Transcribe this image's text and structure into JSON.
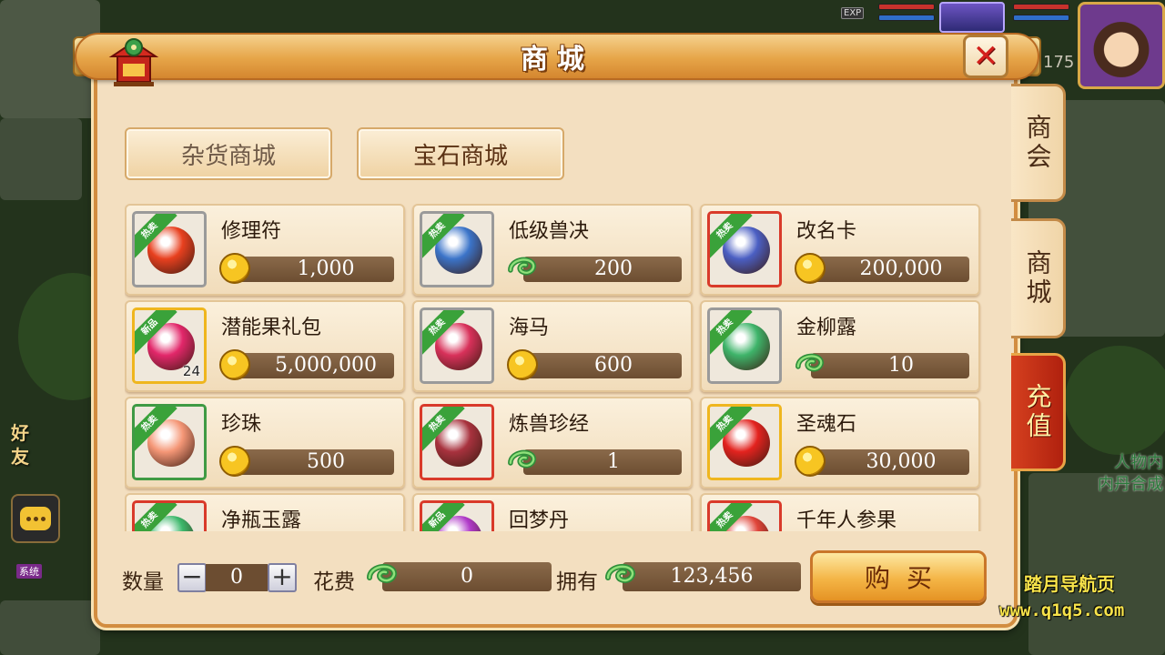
{
  "panel": {
    "title": "商城",
    "close_label": "✕"
  },
  "category_tabs": [
    {
      "label": "杂货商城",
      "active": true
    },
    {
      "label": "宝石商城",
      "active": false
    }
  ],
  "side_tabs": [
    {
      "label": "商会"
    },
    {
      "label": "商城"
    },
    {
      "label": "充值"
    }
  ],
  "items": [
    {
      "name": "修理符",
      "tag": "热卖",
      "currency": "gold-coin-icon",
      "price": "1,000",
      "quality": "grey",
      "art_color": "#e8401f",
      "count": ""
    },
    {
      "name": "低级兽决",
      "tag": "热卖",
      "currency": "jade-icon",
      "price": "200",
      "quality": "grey",
      "art_color": "#3b74c9",
      "count": ""
    },
    {
      "name": "改名卡",
      "tag": "热卖",
      "currency": "gold-coin-icon",
      "price": "200,000",
      "quality": "red",
      "art_color": "#4b5fc3",
      "count": ""
    },
    {
      "name": "潜能果礼包",
      "tag": "新品",
      "currency": "gold-coin-icon",
      "price": "5,000,000",
      "quality": "gold",
      "art_color": "#e2276a",
      "count": "24"
    },
    {
      "name": "海马",
      "tag": "热卖",
      "currency": "gold-coin-icon",
      "price": "600",
      "quality": "grey",
      "art_color": "#d8315a",
      "count": ""
    },
    {
      "name": "金柳露",
      "tag": "热卖",
      "currency": "jade-icon",
      "price": "10",
      "quality": "grey",
      "art_color": "#3eb46a",
      "count": ""
    },
    {
      "name": "珍珠",
      "tag": "热卖",
      "currency": "gold-coin-icon",
      "price": "500",
      "quality": "green",
      "art_color": "#f59777",
      "count": ""
    },
    {
      "name": "炼兽珍经",
      "tag": "热卖",
      "currency": "jade-icon",
      "price": "1",
      "quality": "red",
      "art_color": "#a8323e",
      "count": ""
    },
    {
      "name": "圣魂石",
      "tag": "热卖",
      "currency": "gold-coin-icon",
      "price": "30,000",
      "quality": "gold",
      "art_color": "#e3231f",
      "count": ""
    },
    {
      "name": "净瓶玉露",
      "tag": "热卖",
      "currency": "gold-coin-icon",
      "price": "",
      "quality": "red",
      "art_color": "#3cb86b",
      "count": ""
    },
    {
      "name": "回梦丹",
      "tag": "新品",
      "currency": "gold-coin-icon",
      "price": "",
      "quality": "red",
      "art_color": "#b03ac9",
      "count": ""
    },
    {
      "name": "千年人参果",
      "tag": "热卖",
      "currency": "gold-coin-icon",
      "price": "",
      "quality": "red",
      "art_color": "#e0453a",
      "count": ""
    }
  ],
  "footer": {
    "qty_label": "数量",
    "qty_minus": "−",
    "qty_value": "0",
    "qty_plus": "+",
    "cost_label": "花费",
    "cost_value": "0",
    "own_label": "拥有",
    "own_value": "123,456",
    "buy_label": "购买"
  },
  "hud": {
    "exp_label": "EXP",
    "level_text": "175",
    "right_hint_1": "人物内",
    "right_hint_2": "内丹合成",
    "left_text_1": "好",
    "left_text_2": "友",
    "sys_tag": "系统"
  },
  "watermark": {
    "title": "踏月导航页",
    "url": "www.q1q5.com"
  },
  "colors": {
    "panel_bg": "#f3dfc0",
    "accent_orange": "#e6a548",
    "price_bar": "#6c4d31",
    "hot_ribbon": "#3aa23a",
    "recharge_red": "#c22f14"
  }
}
